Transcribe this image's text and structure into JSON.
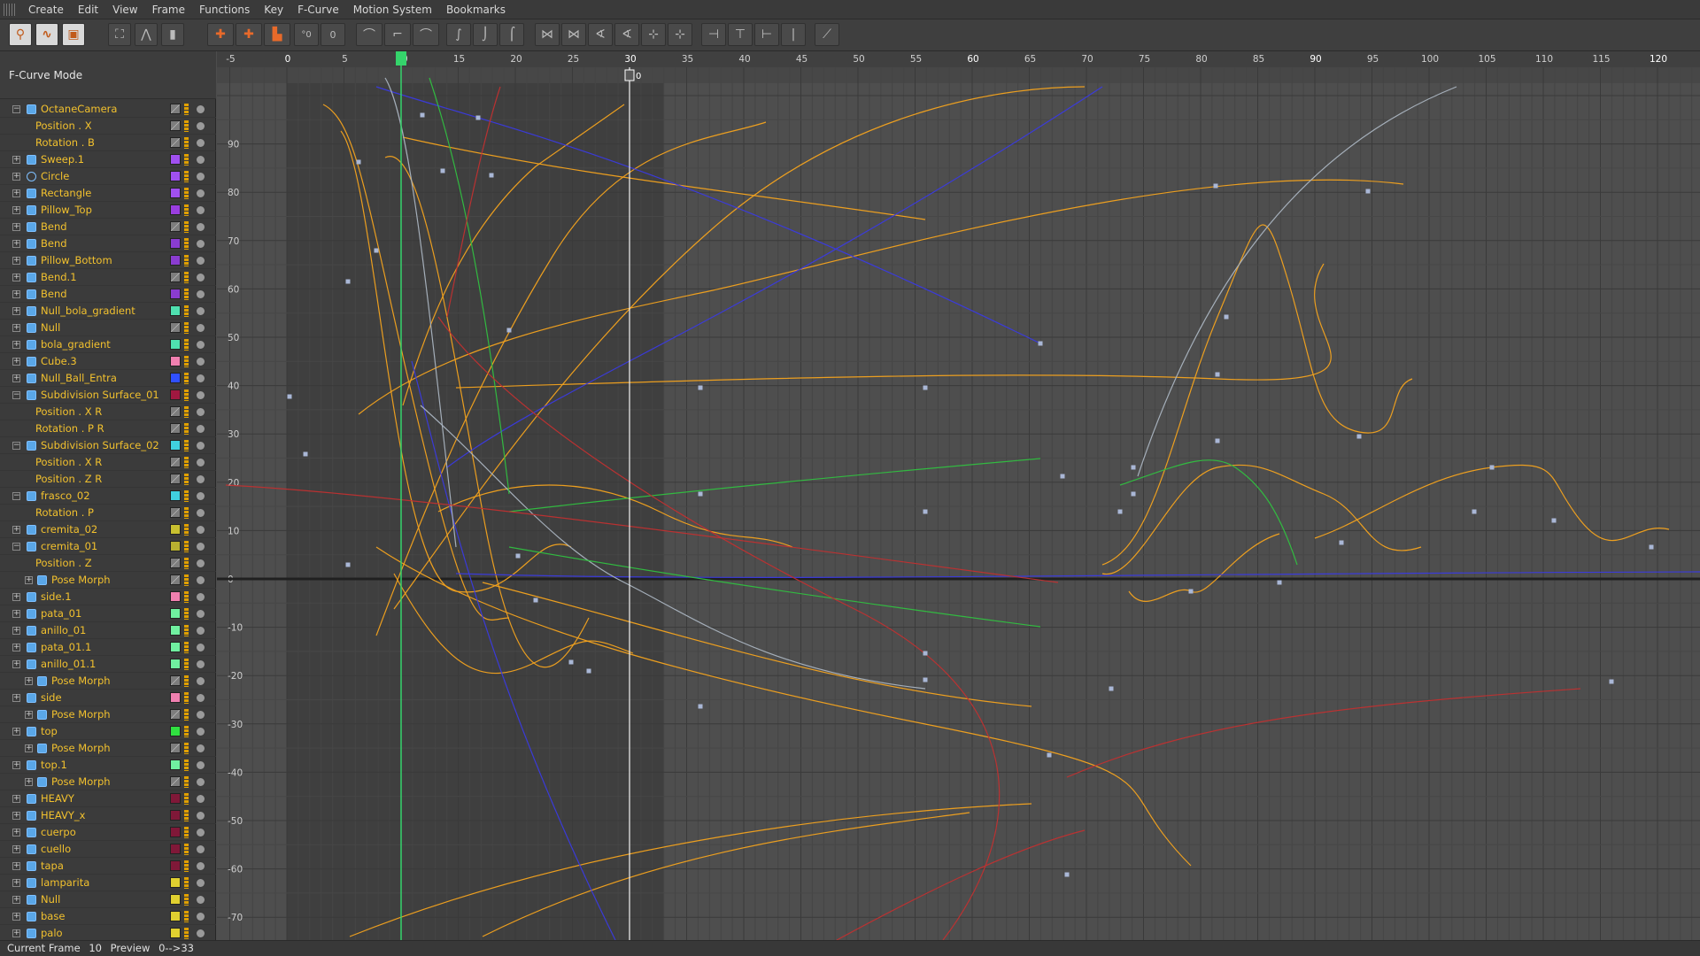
{
  "menu": [
    "Create",
    "Edit",
    "View",
    "Frame",
    "Functions",
    "Key",
    "F-Curve",
    "Motion System",
    "Bookmarks"
  ],
  "panel": {
    "mode_label": "F-Curve Mode"
  },
  "tree": [
    {
      "label": "OctaneCamera",
      "indent": 0,
      "exp": "minus",
      "icon": "camera-icon",
      "color": "#7d7d7d"
    },
    {
      "label": "Position . X",
      "indent": 2,
      "exp": "",
      "icon": "",
      "color": "#7d7d7d"
    },
    {
      "label": "Rotation . B",
      "indent": 2,
      "exp": "",
      "icon": "",
      "color": "#7d7d7d"
    },
    {
      "label": "Sweep.1",
      "indent": 0,
      "exp": "plus",
      "icon": "sweep-icon",
      "color": "#a050f0"
    },
    {
      "label": "Circle",
      "indent": 0,
      "exp": "plus",
      "icon": "circle-icon",
      "color": "#a050f0"
    },
    {
      "label": "Rectangle",
      "indent": 0,
      "exp": "plus",
      "icon": "rectangle-icon",
      "color": "#a050f0"
    },
    {
      "label": "Pillow_Top",
      "indent": 0,
      "exp": "plus",
      "icon": "polygon-object-icon",
      "color": "#9a3ee0"
    },
    {
      "label": "Bend",
      "indent": 0,
      "exp": "plus",
      "icon": "bend-deformer-icon",
      "color": "#7d7d7d"
    },
    {
      "label": "Bend",
      "indent": 0,
      "exp": "plus",
      "icon": "bend-deformer-icon",
      "color": "#8a3cd0"
    },
    {
      "label": "Pillow_Bottom",
      "indent": 0,
      "exp": "plus",
      "icon": "polygon-object-icon",
      "color": "#8a3cd0"
    },
    {
      "label": "Bend.1",
      "indent": 0,
      "exp": "plus",
      "icon": "bend-deformer-icon",
      "color": "#7d7d7d"
    },
    {
      "label": "Bend",
      "indent": 0,
      "exp": "plus",
      "icon": "bend-deformer-icon",
      "color": "#8a3cd0"
    },
    {
      "label": "Null_bola_gradient",
      "indent": 0,
      "exp": "plus",
      "icon": "null-object-icon",
      "color": "#4fe0b0"
    },
    {
      "label": "Null",
      "indent": 0,
      "exp": "plus",
      "icon": "null-object-icon",
      "color": "#7d7d7d"
    },
    {
      "label": "bola_gradient",
      "indent": 0,
      "exp": "plus",
      "icon": "polygon-object-icon",
      "color": "#4fe0b0"
    },
    {
      "label": "Cube.3",
      "indent": 0,
      "exp": "plus",
      "icon": "cube-icon",
      "color": "#f080b0"
    },
    {
      "label": "Null_Ball_Entra",
      "indent": 0,
      "exp": "plus",
      "icon": "null-object-icon",
      "color": "#3050ff"
    },
    {
      "label": "Subdivision Surface_01",
      "indent": 0,
      "exp": "minus",
      "icon": "subdivision-surface-icon",
      "color": "#a01840"
    },
    {
      "label": "Position . X  R",
      "indent": 2,
      "exp": "",
      "icon": "",
      "color": "#7d7d7d"
    },
    {
      "label": "Rotation . P  R",
      "indent": 2,
      "exp": "",
      "icon": "",
      "color": "#7d7d7d"
    },
    {
      "label": "Subdivision Surface_02",
      "indent": 0,
      "exp": "minus",
      "icon": "subdivision-surface-icon",
      "color": "#40d0e0"
    },
    {
      "label": "Position . X  R",
      "indent": 2,
      "exp": "",
      "icon": "",
      "color": "#7d7d7d"
    },
    {
      "label": "Position . Z  R",
      "indent": 2,
      "exp": "",
      "icon": "",
      "color": "#7d7d7d"
    },
    {
      "label": "frasco_02",
      "indent": 0,
      "exp": "minus",
      "icon": "polygon-object-icon",
      "color": "#40d0e0"
    },
    {
      "label": "Rotation . P",
      "indent": 2,
      "exp": "",
      "icon": "",
      "color": "#7d7d7d"
    },
    {
      "label": "cremita_02",
      "indent": 0,
      "exp": "plus",
      "icon": "null-object-icon",
      "color": "#c8c030"
    },
    {
      "label": "cremita_01",
      "indent": 0,
      "exp": "minus",
      "icon": "null-object-icon",
      "color": "#b8b030"
    },
    {
      "label": "Position . Z",
      "indent": 2,
      "exp": "",
      "icon": "",
      "color": "#7d7d7d"
    },
    {
      "label": "Pose Morph",
      "indent": 1,
      "exp": "plus",
      "icon": "pose-morph-icon",
      "color": "#7d7d7d"
    },
    {
      "label": "side.1",
      "indent": 0,
      "exp": "plus",
      "icon": "null-object-icon",
      "color": "#f080b0"
    },
    {
      "label": "pata_01",
      "indent": 0,
      "exp": "plus",
      "icon": "polygon-object-icon",
      "color": "#70f0a0"
    },
    {
      "label": "anillo_01",
      "indent": 0,
      "exp": "plus",
      "icon": "polygon-object-icon",
      "color": "#70f0a0"
    },
    {
      "label": "pata_01.1",
      "indent": 0,
      "exp": "plus",
      "icon": "polygon-object-icon",
      "color": "#70f0a0"
    },
    {
      "label": "anillo_01.1",
      "indent": 0,
      "exp": "plus",
      "icon": "polygon-object-icon",
      "color": "#70f0a0"
    },
    {
      "label": "Pose Morph",
      "indent": 1,
      "exp": "plus",
      "icon": "pose-morph-icon",
      "color": "#7d7d7d"
    },
    {
      "label": "side",
      "indent": 0,
      "exp": "plus",
      "icon": "null-object-icon",
      "color": "#f080b0"
    },
    {
      "label": "Pose Morph",
      "indent": 1,
      "exp": "plus",
      "icon": "pose-morph-icon",
      "color": "#7d7d7d"
    },
    {
      "label": "top",
      "indent": 0,
      "exp": "plus",
      "icon": "polygon-object-icon",
      "color": "#30e040"
    },
    {
      "label": "Pose Morph",
      "indent": 1,
      "exp": "plus",
      "icon": "pose-morph-icon",
      "color": "#7d7d7d"
    },
    {
      "label": "top.1",
      "indent": 0,
      "exp": "plus",
      "icon": "polygon-object-icon",
      "color": "#70f0a0"
    },
    {
      "label": "Pose Morph",
      "indent": 1,
      "exp": "plus",
      "icon": "pose-morph-icon",
      "color": "#7d7d7d"
    },
    {
      "label": "HEAVY",
      "indent": 0,
      "exp": "plus",
      "icon": "null-object-icon",
      "color": "#801838"
    },
    {
      "label": "HEAVY_x",
      "indent": 0,
      "exp": "plus",
      "icon": "null-object-icon",
      "color": "#801838"
    },
    {
      "label": "cuerpo",
      "indent": 0,
      "exp": "plus",
      "icon": "cube-icon",
      "color": "#801838"
    },
    {
      "label": "cuello",
      "indent": 0,
      "exp": "plus",
      "icon": "cylinder-icon",
      "color": "#801838"
    },
    {
      "label": "tapa",
      "indent": 0,
      "exp": "plus",
      "icon": "cylinder-icon",
      "color": "#801838"
    },
    {
      "label": "lamparita",
      "indent": 0,
      "exp": "plus",
      "icon": "null-object-icon",
      "color": "#e0d030"
    },
    {
      "label": "Null",
      "indent": 0,
      "exp": "plus",
      "icon": "null-object-icon",
      "color": "#e0d030"
    },
    {
      "label": "base",
      "indent": 0,
      "exp": "plus",
      "icon": "cylinder-icon",
      "color": "#e0d030"
    },
    {
      "label": "palo",
      "indent": 0,
      "exp": "plus",
      "icon": "cylinder-icon",
      "color": "#e0d030"
    }
  ],
  "timeline": {
    "frame_min": -5,
    "frame_max": 120,
    "frame_step": 5,
    "value_min": -75,
    "value_max": 100,
    "value_step": 10,
    "current_frame": 10,
    "playhead_frame": 30,
    "playhead_label": "0",
    "preview_start": 0,
    "preview_end": 33
  },
  "status": {
    "current_frame_label": "Current Frame",
    "current_frame": "10",
    "preview_label": "Preview",
    "preview_range": "0-->33"
  },
  "colors": {
    "curve_orange": "#f4a31e",
    "curve_blue": "#3a3ae0",
    "curve_red": "#c03030",
    "curve_green": "#30c040",
    "curve_grey": "#aab4c0",
    "current_frame": "#35d46b"
  }
}
